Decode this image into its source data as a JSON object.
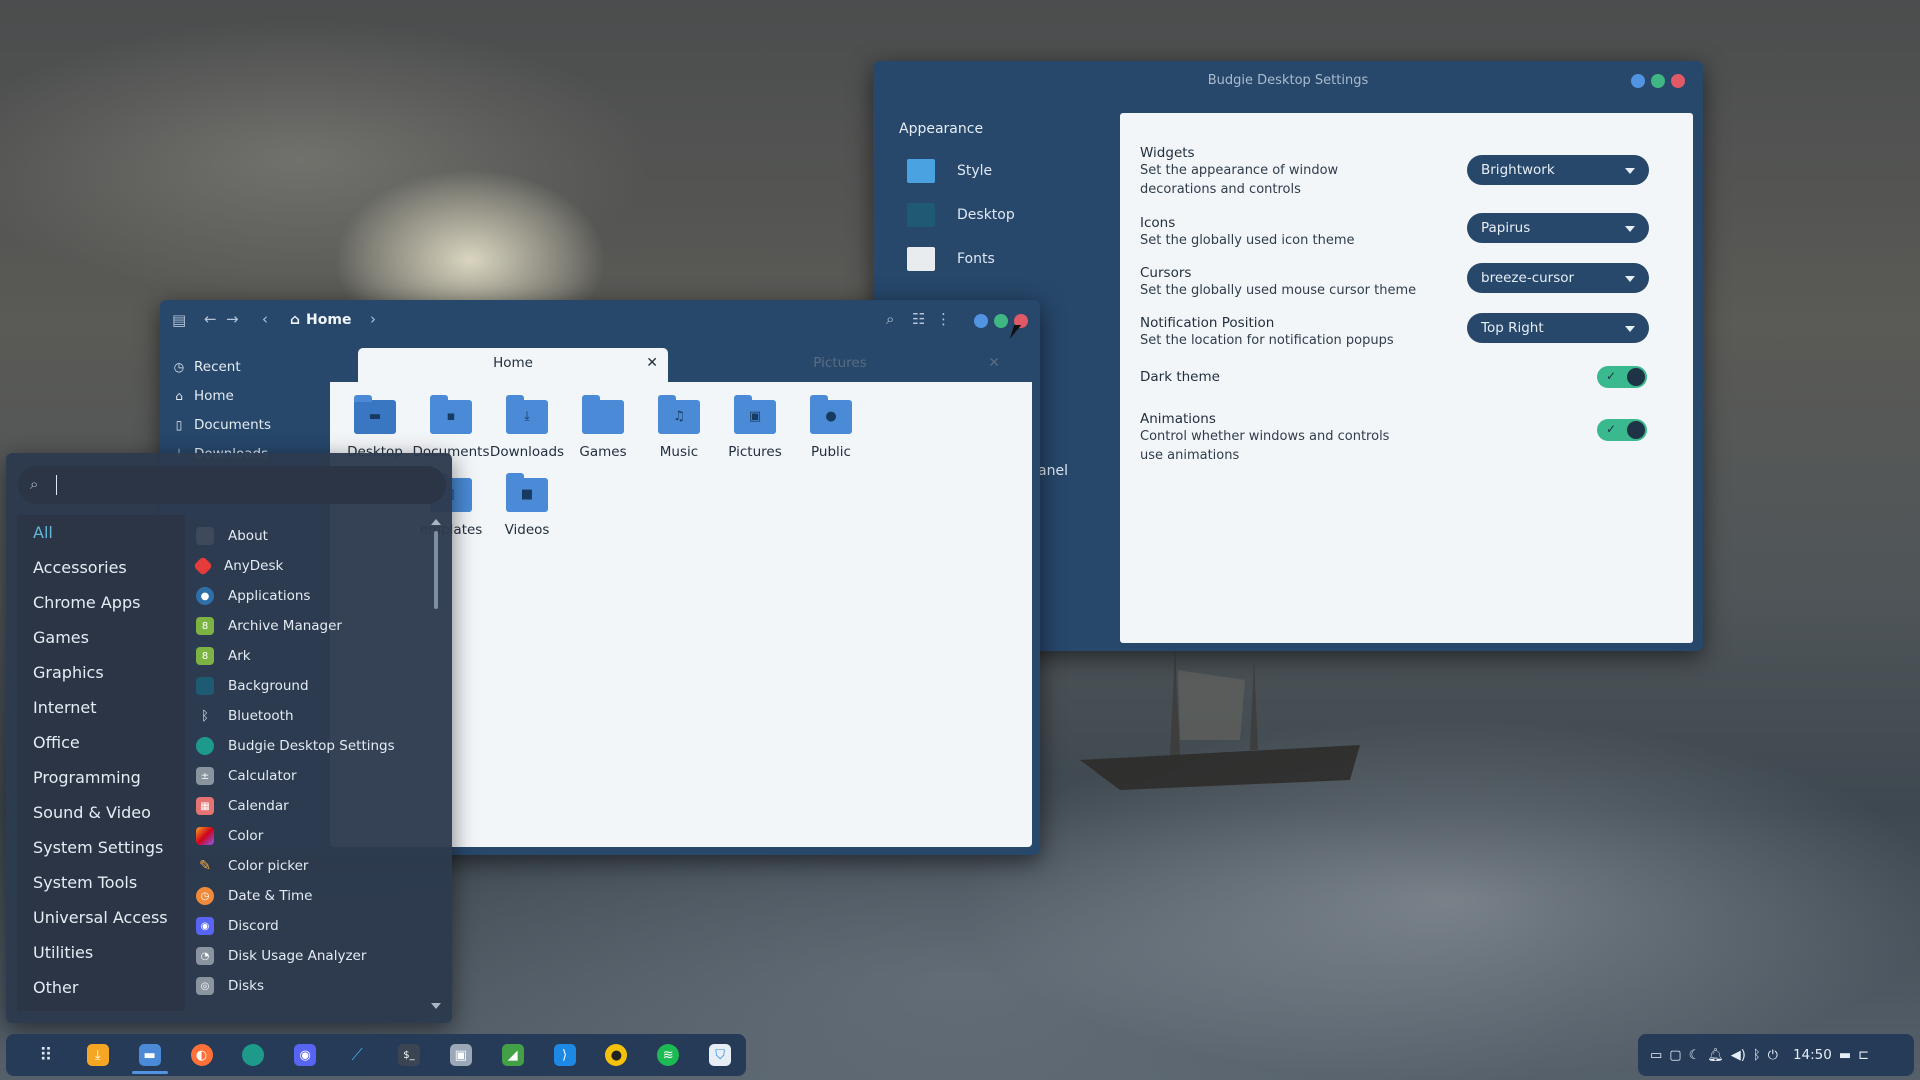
{
  "settings": {
    "title": "Budgie Desktop Settings",
    "sidebar_heading": "Appearance",
    "sidebar_items": [
      "Style",
      "Desktop",
      "Fonts"
    ],
    "panel_partial": "anel",
    "rows": [
      {
        "title": "Widgets",
        "desc": "Set the appearance of window decorations and controls",
        "desc1": "Set the appearance of window",
        "desc2": "decorations and controls",
        "value": "Brightwork"
      },
      {
        "title": "Icons",
        "desc": "Set the globally used icon theme",
        "value": "Papirus"
      },
      {
        "title": "Cursors",
        "desc": "Set the globally used mouse cursor theme",
        "value": "breeze-cursor"
      },
      {
        "title": "Notification Position",
        "desc": "Set the location for notification popups",
        "value": "Top Right"
      },
      {
        "title": "Dark theme",
        "enabled": true
      },
      {
        "title": "Animations",
        "desc1": "Control whether windows and controls",
        "desc2": "use animations",
        "enabled": true
      }
    ]
  },
  "files": {
    "location": "Home",
    "sidebar": [
      "Recent",
      "Home",
      "Documents",
      "Downloads"
    ],
    "tabs": [
      "Home",
      "Pictures"
    ],
    "folders": [
      "Desktop",
      "Documents",
      "Downloads",
      "Games",
      "Music",
      "Pictures",
      "Public",
      "Templates",
      "Videos"
    ],
    "folder_partial": "emplates"
  },
  "menu": {
    "search_placeholder": "",
    "categories": [
      "All",
      "Accessories",
      "Chrome Apps",
      "Games",
      "Graphics",
      "Internet",
      "Office",
      "Programming",
      "Sound & Video",
      "System Settings",
      "System Tools",
      "Universal Access",
      "Utilities",
      "Other"
    ],
    "active_category": "All",
    "apps": [
      "About",
      "AnyDesk",
      "Applications",
      "Archive Manager",
      "Ark",
      "Background",
      "Bluetooth",
      "Budgie Desktop Settings",
      "Calculator",
      "Calendar",
      "Color",
      "Color picker",
      "Date & Time",
      "Discord",
      "Disk Usage Analyzer",
      "Disks"
    ]
  },
  "tray": {
    "clock": "14:50"
  },
  "colors": {
    "accent": "#5294e2",
    "window_bg": "#27476b",
    "toggle_on": "#3ab88e",
    "close": "#e05a66",
    "maximize": "#3fb783"
  }
}
